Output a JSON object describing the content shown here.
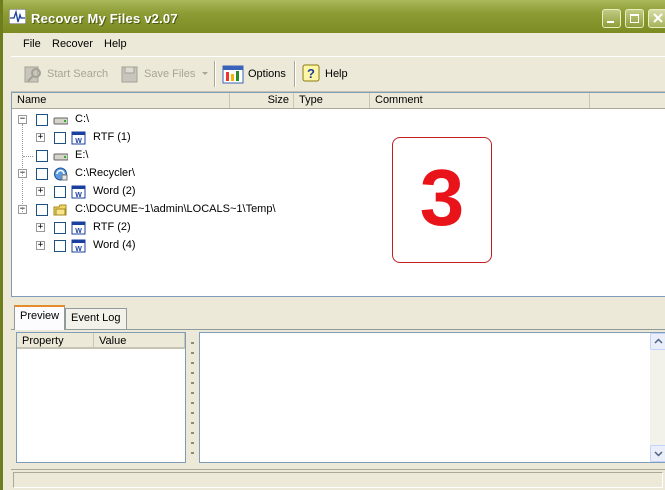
{
  "window": {
    "title": "Recover My Files v2.07"
  },
  "menu": {
    "items": [
      "File",
      "Recover",
      "Help"
    ]
  },
  "toolbar": {
    "start_search": "Start Search",
    "save_files": "Save Files",
    "options": "Options",
    "help": "Help"
  },
  "tree": {
    "columns": [
      "Name",
      "Size",
      "Type",
      "Comment"
    ],
    "rows": [
      {
        "label": "C:\\",
        "level": 0,
        "icon": "drive-icon",
        "expander": "minus"
      },
      {
        "label": "RTF  (1)",
        "level": 1,
        "icon": "document-icon",
        "expander": "plus"
      },
      {
        "label": "E:\\",
        "level": 0,
        "icon": "drive-icon",
        "expander": "none"
      },
      {
        "label": "C:\\Recycler\\",
        "level": 0,
        "icon": "recycle-bin-icon",
        "expander": "minus"
      },
      {
        "label": "Word  (2)",
        "level": 1,
        "icon": "document-icon",
        "expander": "plus"
      },
      {
        "label": "C:\\DOCUME~1\\admin\\LOCALS~1\\Temp\\",
        "level": 0,
        "icon": "folder-icon",
        "expander": "minus"
      },
      {
        "label": "RTF  (2)",
        "level": 1,
        "icon": "document-icon",
        "expander": "plus"
      },
      {
        "label": "Word  (4)",
        "level": 1,
        "icon": "document-icon",
        "expander": "plus"
      }
    ]
  },
  "step_badge": "3",
  "tabs": [
    "Preview",
    "Event Log"
  ],
  "properties": {
    "columns": [
      "Property",
      "Value"
    ]
  },
  "colors": {
    "title_bar": "#8d9c34",
    "badge_red": "#e8141a",
    "pane_border": "#7f9db9"
  }
}
